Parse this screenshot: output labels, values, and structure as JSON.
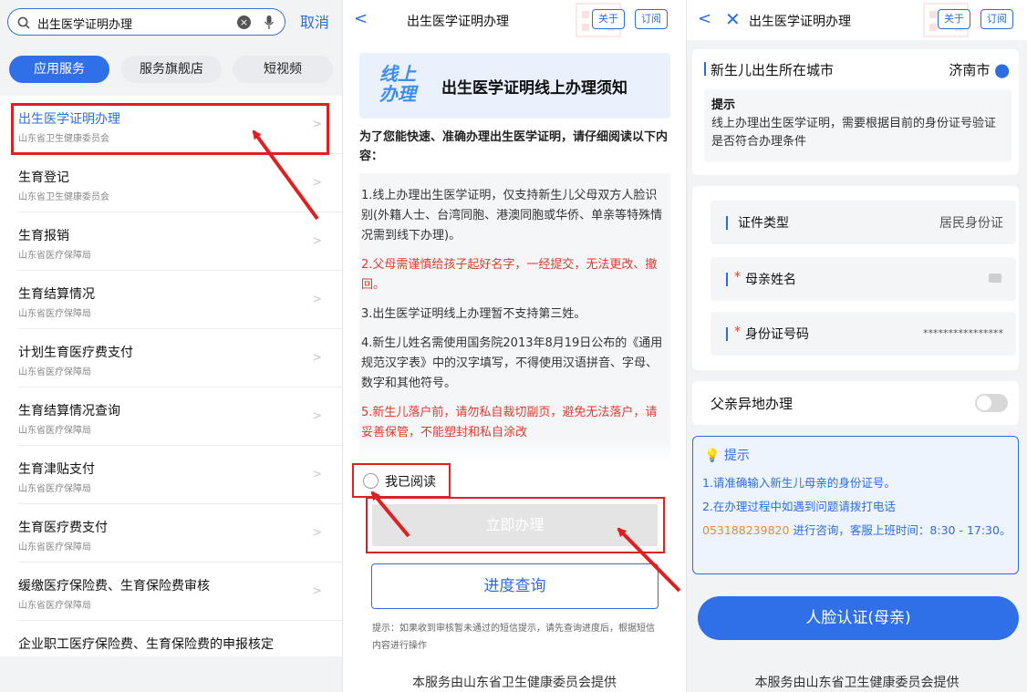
{
  "colors": {
    "accent": "#2f6fe8",
    "annotation": "#e02020",
    "warning_text": "#e03a2c",
    "phone": "#f08a1c"
  },
  "panel1": {
    "search": {
      "value": "出生医学证明办理",
      "icons": [
        "search-icon",
        "clear-icon",
        "mic-icon"
      ]
    },
    "cancel_label": "取消",
    "tabs": [
      "应用服务",
      "服务旗舰店",
      "短视频"
    ],
    "items": [
      {
        "title": "出生医学证明办理",
        "subtitle": "山东省卫生健康委员会",
        "highlighted": true
      },
      {
        "title": "生育登记",
        "subtitle": "山东省卫生健康委员会"
      },
      {
        "title": "生育报销",
        "subtitle": "山东省医疗保障局"
      },
      {
        "title": "生育结算情况",
        "subtitle": "山东省医疗保障局"
      },
      {
        "title": "计划生育医疗费支付",
        "subtitle": "山东省医疗保障局"
      },
      {
        "title": "生育结算情况查询",
        "subtitle": "山东省医疗保障局"
      },
      {
        "title": "生育津贴支付",
        "subtitle": "山东省医疗保障局"
      },
      {
        "title": "生育医疗费支付",
        "subtitle": "山东省医疗保障局"
      },
      {
        "title": "缓缴医疗保险费、生育保险费审核",
        "subtitle": "山东省医疗保障局"
      },
      {
        "title": "企业职工医疗保险费、生育保险费的申报核定",
        "subtitle": ""
      }
    ]
  },
  "panel2": {
    "title": "出生医学证明办理",
    "about": "关于",
    "subscribe": "订阅",
    "notice_logo_line1": "线上",
    "notice_logo_line2": "办理",
    "notice_title": "出生医学证明线上办理须知",
    "intro": "为了您能快速、准确办理出生医学证明，请仔细阅读以下内容：",
    "rules": [
      {
        "text": "1.线上办理出生医学证明，仅支持新生儿父母双方人脸识别(外籍人士、台湾同胞、港澳同胞或华侨、单亲等特殊情况需到线下办理)。",
        "warn": false
      },
      {
        "text": "2.父母需谨慎给孩子起好名字，一经提交，无法更改、撤回。",
        "warn": true
      },
      {
        "text": "3.出生医学证明线上办理暂不支持第三姓。",
        "warn": false
      },
      {
        "text": "4.新生儿姓名需使用国务院2013年8月19日公布的《通用规范汉字表》中的汉字填写，不得使用汉语拼音、字母、数字和其他符号。",
        "warn": false
      },
      {
        "text": "5.新生儿落户前，请勿私自裁切副页，避免无法落户，请妥善保管，不能塑封和私自涂改",
        "warn": true
      }
    ],
    "read_label": "我已阅读",
    "apply_label": "立即办理",
    "progress_label": "进度查询",
    "tip": "提示：如果收到审核暂未通过的短信提示，请先查询进度后，根据短信内容进行操作",
    "footer": "本服务由山东省卫生健康委员会提供"
  },
  "panel3": {
    "title": "出生医学证明办理",
    "about": "关于",
    "subscribe": "订阅",
    "city_label": "新生儿出生所在城市",
    "city_value": "济南市",
    "notice_heading": "提示",
    "notice_body": "线上办理出生医学证明，需要根据目前的身份证号验证是否符合办理条件",
    "id_type_label": "证件类型",
    "id_type_value": "居民身份证",
    "mother_name_label": "母亲姓名",
    "id_number_label": "身份证号码",
    "id_number_value": "****************",
    "father_remote_label": "父亲异地办理",
    "father_remote_on": false,
    "tips_heading": "提示",
    "tip_1": "1.请准确输入新生儿母亲的身份证号。",
    "tip_2": "2.在办理过程中如遇到问题请拨打电话",
    "tip_phone": "053188239820",
    "tip_3": " 进行咨询，客服上班时间：8:30 - 17:30。",
    "face_button": "人脸认证(母亲)",
    "footer": "本服务由山东省卫生健康委员会提供"
  }
}
